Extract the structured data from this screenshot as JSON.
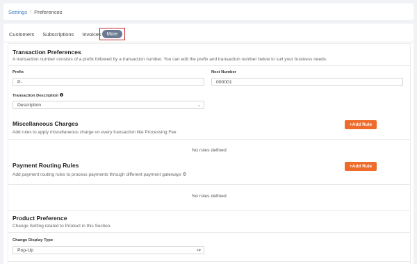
{
  "breadcrumb": {
    "parent": "Settings",
    "separator": "›",
    "current": "Preferences"
  },
  "tabs": [
    {
      "label": "Customers"
    },
    {
      "label": "Subscriptions"
    },
    {
      "label": "Invoices"
    },
    {
      "label": "More",
      "active": true
    }
  ],
  "transaction": {
    "title": "Transaction Preferences",
    "description": "A transaction number consists of a prefix followed by a transaction number. You can edit the prefix and transaction number below to suit your business needs.",
    "prefix_label": "Prefix",
    "prefix_value": "P-",
    "next_number_label": "Next Number",
    "next_number_value": "000001",
    "description_label": "Transaction Description",
    "description_select": "Description"
  },
  "misc_charges": {
    "title": "Miscellaneous Charges",
    "description": "Add rules to apply miscellaneous charge on every transaction like Processing Fee",
    "button": "+Add Rule",
    "empty": "No rules defined"
  },
  "payment_routing": {
    "title": "Payment Routing Rules",
    "description": "Add payment routing rules to process payments through different payment gateways",
    "button": "+Add Rule",
    "empty": "No rules defined"
  },
  "product": {
    "title": "Product Preference",
    "description": "Change Setting related to Product in this Section.",
    "display_type_label": "Change Display Type",
    "display_type_value": "Pop-Up"
  },
  "icons": {
    "info": "info-icon",
    "help": "help-circle-icon",
    "chevron": "chevron-down-icon",
    "clear": "clear-icon"
  },
  "colors": {
    "accent_button": "#ef6b2b",
    "active_tab": "#6b7a90",
    "highlight_border": "#c0282d",
    "link": "#3b82c4"
  }
}
